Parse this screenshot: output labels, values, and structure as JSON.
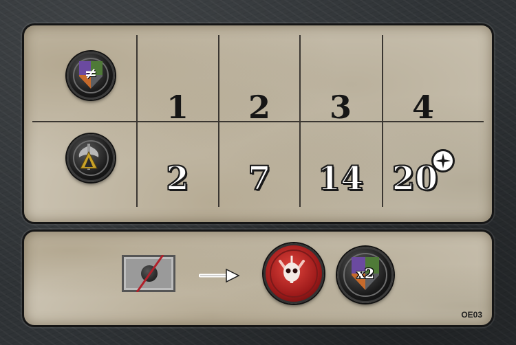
{
  "cost_row": {
    "icon": "faction-shield-not-equal-icon",
    "values": [
      "1",
      "2",
      "3",
      "4"
    ]
  },
  "reward_row": {
    "icon": "axe-and-power-icon",
    "values": [
      "2",
      "7",
      "14",
      "20"
    ],
    "last_value_suffix_icon": "star-circle-icon"
  },
  "effect": {
    "discard_icon": "crossed-out-tile-icon",
    "arrow_icon": "right-arrow-icon",
    "skull_token_icon": "red-skull-token-icon",
    "shield_token_icon": "faction-shield-token-icon",
    "multiplier": "x2"
  },
  "card_code": "OE03",
  "colors": {
    "parchment": "#cbc3b2",
    "frame": "#2f3336",
    "skull_red": "#c1272d",
    "shield_purple": "#6b4aa0",
    "shield_green": "#4f7a38",
    "shield_orange": "#c66a2b",
    "shield_gray": "#5d5f63"
  }
}
